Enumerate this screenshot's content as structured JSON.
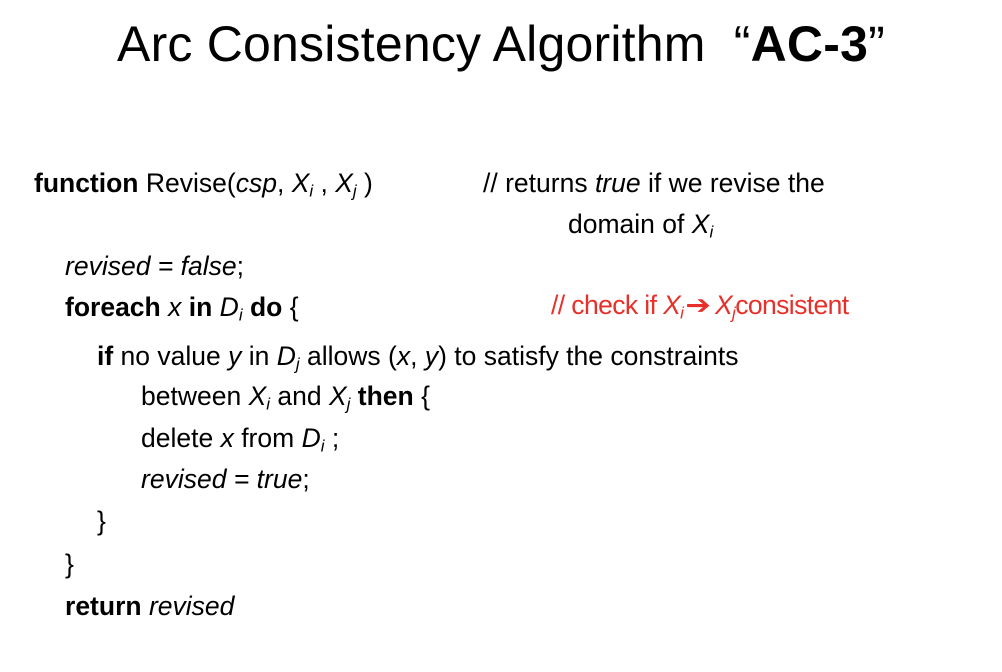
{
  "title": {
    "main": "Arc Consistency Algorithm",
    "open_quote": "“",
    "bold": "AC-3",
    "close_quote": "”"
  },
  "code": {
    "kw_function": "function",
    "revise_name": "Revise(",
    "csp": "csp",
    "comma1": ", ",
    "X": "X",
    "sub_i": "i",
    "sub_j": "j",
    "comma2": " , ",
    "close_paren": " )",
    "comment1_a": "// returns ",
    "comment1_true": "true",
    "comment1_b": " if we revise the",
    "comment1_line2": "domain of ",
    "revised_init_var": "revised",
    "revised_init_eq": " = ",
    "revised_init_val": "false",
    "semicolon": ";",
    "kw_foreach": "foreach",
    "x": "x",
    "kw_in": "in",
    "D": "D",
    "kw_do": "do",
    "open_brace": " {",
    "comment2_a": "// check if ",
    "comment2_arrow": "➔",
    "comment2_b": "consistent",
    "kw_if": "if",
    "if_text_a": " no value ",
    "y": "y",
    "if_text_b": " in ",
    "if_text_c": " allows (",
    "if_text_comma": ", ",
    "if_text_d": ") to satisfy the constraints",
    "between": "between ",
    "and": " and ",
    "kw_then": "then",
    "delete": "delete ",
    "from": " from ",
    "delete_end": " ;",
    "revised_set_val": "true",
    "close_brace": "}",
    "kw_return": "return",
    "return_var": "revised"
  },
  "colors": {
    "text": "#000000",
    "comment_red": "#e8302a",
    "background": "#ffffff"
  }
}
